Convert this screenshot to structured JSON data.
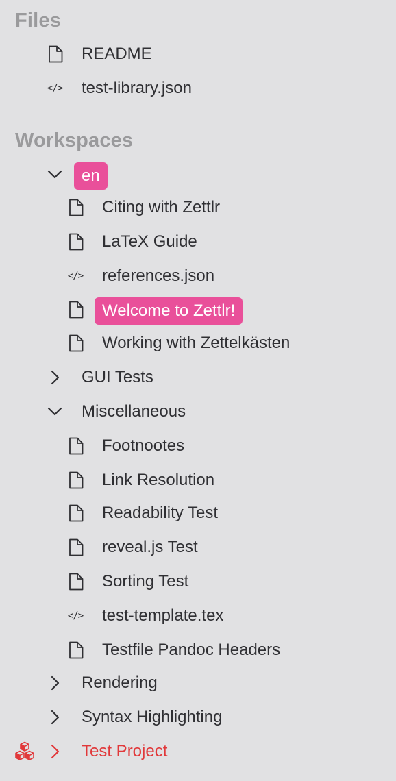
{
  "files": {
    "heading": "Files",
    "items": [
      {
        "label": "README",
        "icon": "file-icon"
      },
      {
        "label": "test-library.json",
        "icon": "code-file-icon"
      }
    ]
  },
  "workspaces": {
    "heading": "Workspaces",
    "en": {
      "label": "en",
      "expanded": true,
      "tag_color": "#e9509a",
      "items": [
        {
          "label": "Citing with Zettlr",
          "icon": "file-icon"
        },
        {
          "label": "LaTeX Guide",
          "icon": "file-icon"
        },
        {
          "label": "references.json",
          "icon": "code-file-icon"
        },
        {
          "label": "Welcome to Zettlr!",
          "icon": "file-icon",
          "selected": true
        },
        {
          "label": "Working with Zettelkästen",
          "icon": "file-icon"
        }
      ]
    },
    "gui_tests": {
      "label": "GUI Tests",
      "expanded": false
    },
    "miscellaneous": {
      "label": "Miscellaneous",
      "expanded": true,
      "items": [
        {
          "label": "Footnootes",
          "icon": "file-icon"
        },
        {
          "label": "Link Resolution",
          "icon": "file-icon"
        },
        {
          "label": "Readability Test",
          "icon": "file-icon"
        },
        {
          "label": "reveal.js Test",
          "icon": "file-icon"
        },
        {
          "label": "Sorting Test",
          "icon": "file-icon"
        },
        {
          "label": "test-template.tex",
          "icon": "code-file-icon"
        },
        {
          "label": "Testfile Pandoc Headers",
          "icon": "file-icon"
        }
      ]
    },
    "rendering": {
      "label": "Rendering",
      "expanded": false
    },
    "syntax_highlighting": {
      "label": "Syntax Highlighting",
      "expanded": false
    },
    "test_project": {
      "label": "Test Project",
      "expanded": false,
      "icon": "project-cubes-icon",
      "color": "#e1383a"
    }
  },
  "code_glyph": "</>",
  "colors": {
    "background": "#e1e1e3",
    "heading": "#9a9a9c",
    "text": "#2f2f33",
    "accent_pink": "#e9509a",
    "project_red": "#e1383a"
  }
}
